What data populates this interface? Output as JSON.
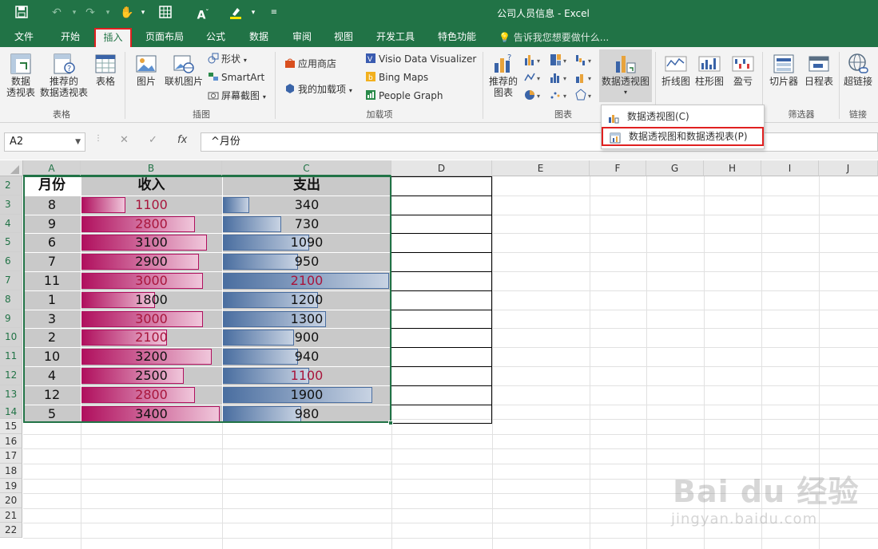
{
  "window": {
    "title": "公司人员信息 - Excel",
    "accent": "#217346"
  },
  "tabs": [
    "文件",
    "开始",
    "插入",
    "页面布局",
    "公式",
    "数据",
    "审阅",
    "视图",
    "开发工具",
    "特色功能"
  ],
  "active_tab": "插入",
  "tell_me": "告诉我您想要做什么...",
  "ribbon": {
    "tables": {
      "pivot_line1": "数据",
      "pivot_line2": "透视表",
      "recommended_line1": "推荐的",
      "recommended_line2": "数据透视表",
      "table": "表格",
      "group": "表格"
    },
    "illustrations": {
      "picture": "图片",
      "online_picture": "联机图片",
      "shapes": "形状",
      "smartart": "SmartArt",
      "screenshot": "屏幕截图",
      "group": "插图"
    },
    "addins": {
      "store": "应用商店",
      "my_addins": "我的加载项",
      "visio": "Visio Data Visualizer",
      "bing": "Bing Maps",
      "people": "People Graph",
      "group": "加载项"
    },
    "charts": {
      "recommended_line1": "推荐的",
      "recommended_line2": "图表",
      "pivot_chart": "数据透视图",
      "group": "图表"
    },
    "sparklines": {
      "line": "折线图",
      "column": "柱形图",
      "winloss": "盈亏"
    },
    "filters": {
      "slicer": "切片器",
      "timeline": "日程表",
      "group": "筛选器"
    },
    "links": {
      "hyperlink": "超链接",
      "group": "链接"
    }
  },
  "dropdown": {
    "item1": "数据透视图(C)",
    "item2": "数据透视图和数据透视表(P)"
  },
  "formula_bar": {
    "name_box": "A2",
    "formula": "^月份",
    "cancel": "✕",
    "enter": "✓",
    "fx": "fx"
  },
  "columns": [
    "A",
    "B",
    "C",
    "D",
    "E",
    "F",
    "G",
    "H",
    "I",
    "J"
  ],
  "rows": [
    "2",
    "3",
    "4",
    "5",
    "6",
    "7",
    "8",
    "9",
    "10",
    "11",
    "12",
    "13",
    "14",
    "15",
    "16",
    "17",
    "18",
    "19",
    "20",
    "21",
    "22"
  ],
  "table": {
    "headers": [
      "月份",
      "收入",
      "支出"
    ],
    "rows": [
      {
        "month": "8",
        "income": "1100",
        "expense": "340",
        "inc_frac": 0.32,
        "exp_frac": 0.16,
        "inc_red": true,
        "exp_red": false
      },
      {
        "month": "9",
        "income": "2800",
        "expense": "730",
        "inc_frac": 0.82,
        "exp_frac": 0.35,
        "inc_red": true,
        "exp_red": false
      },
      {
        "month": "6",
        "income": "3100",
        "expense": "1090",
        "inc_frac": 0.91,
        "exp_frac": 0.52,
        "inc_red": false,
        "exp_red": false
      },
      {
        "month": "7",
        "income": "2900",
        "expense": "950",
        "inc_frac": 0.85,
        "exp_frac": 0.45,
        "inc_red": false,
        "exp_red": false
      },
      {
        "month": "11",
        "income": "3000",
        "expense": "2100",
        "inc_frac": 0.88,
        "exp_frac": 1.0,
        "inc_red": true,
        "exp_red": true
      },
      {
        "month": "1",
        "income": "1800",
        "expense": "1200",
        "inc_frac": 0.53,
        "exp_frac": 0.57,
        "inc_red": false,
        "exp_red": false
      },
      {
        "month": "3",
        "income": "3000",
        "expense": "1300",
        "inc_frac": 0.88,
        "exp_frac": 0.62,
        "inc_red": true,
        "exp_red": false
      },
      {
        "month": "2",
        "income": "2100",
        "expense": "900",
        "inc_frac": 0.62,
        "exp_frac": 0.43,
        "inc_red": true,
        "exp_red": false
      },
      {
        "month": "10",
        "income": "3200",
        "expense": "940",
        "inc_frac": 0.94,
        "exp_frac": 0.45,
        "inc_red": false,
        "exp_red": false
      },
      {
        "month": "4",
        "income": "2500",
        "expense": "1100",
        "inc_frac": 0.74,
        "exp_frac": 0.52,
        "inc_red": false,
        "exp_red": true
      },
      {
        "month": "12",
        "income": "2800",
        "expense": "1900",
        "inc_frac": 0.82,
        "exp_frac": 0.9,
        "inc_red": true,
        "exp_red": false
      },
      {
        "month": "5",
        "income": "3400",
        "expense": "980",
        "inc_frac": 1.0,
        "exp_frac": 0.47,
        "inc_red": false,
        "exp_red": false
      }
    ]
  },
  "watermark": {
    "brand": "Bai du 经验",
    "url": "jingyan.baidu.com"
  }
}
